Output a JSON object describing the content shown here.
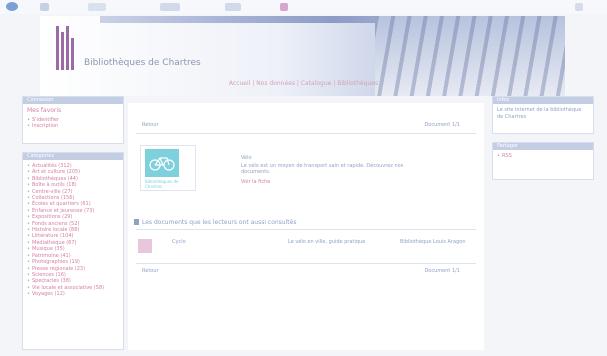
{
  "colors": {
    "accent": "#d37fa2",
    "header": "#c3cde4",
    "link": "#8fa2c6",
    "thumb": "#7ed0dc"
  },
  "toolbar": {
    "icons": [
      "nav-icon",
      "bookmark-icon",
      "search-icon",
      "menu-icon",
      "refresh-icon",
      "settings-icon",
      "close-icon"
    ]
  },
  "banner": {
    "title": "Bibliothèques de Chartres"
  },
  "nav": {
    "links": [
      "Accueil",
      "Nos données",
      "Catalogue",
      "Bibliothèques"
    ]
  },
  "left_box1": {
    "header": "Connexion",
    "link": "Mes favoris",
    "items": [
      "S'identifier",
      "Inscription"
    ]
  },
  "left_box2": {
    "header": "Catégories",
    "items": [
      "Actualités (312)",
      "Art et culture (205)",
      "Bibliothèques (44)",
      "Boîte à outils (18)",
      "Centre-ville (27)",
      "Collections (156)",
      "Écoles et quartiers (61)",
      "Enfance et jeunesse (73)",
      "Expositions (29)",
      "Fonds anciens (52)",
      "Histoire locale (88)",
      "Littérature (104)",
      "Médiathèque (67)",
      "Musique (35)",
      "Patrimoine (41)",
      "Photographies (19)",
      "Presse régionale (23)",
      "Sciences (16)",
      "Spectacles (38)",
      "Vie locale et associative (58)",
      "Voyages (12)"
    ]
  },
  "main": {
    "back": "Retour",
    "pagination": "Document 1/1",
    "item": {
      "title": "Vélo",
      "desc": "Le vélo est un moyen de transport sain et rapide. Découvrez nos documents.",
      "more": "Voir la fiche",
      "thumb_caption": "Bibliothèques de Chartres"
    },
    "also": "Les documents que les lecteurs ont aussi consultés",
    "row": {
      "col1": "Cyclo",
      "col2": "Le vélo en ville, guide pratique",
      "col3": "Bibliothèque Louis Aragon"
    },
    "footer": {
      "back": "Retour",
      "pagination": "Document 1/1"
    }
  },
  "right_box1": {
    "header": "Infos",
    "text": "Le site internet de la bibliothèque de Chartres"
  },
  "right_box2": {
    "header": "Partager",
    "link": "RSS"
  }
}
